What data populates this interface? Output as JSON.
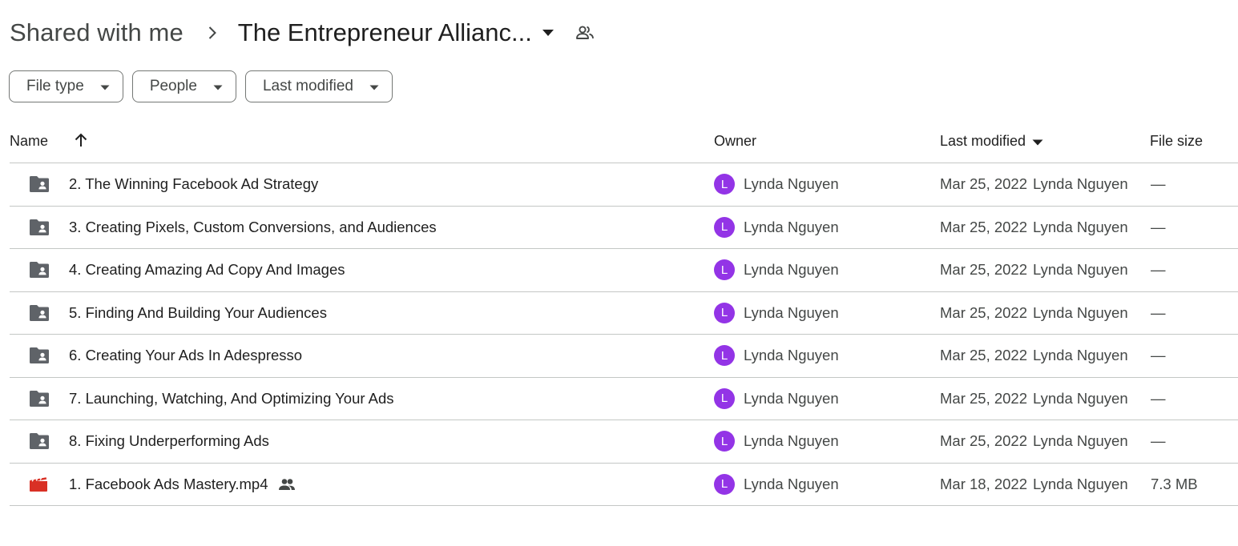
{
  "breadcrumb": {
    "root": "Shared with me",
    "current": "The Entrepreneur Allianc...",
    "separator_icon": "chevron-right-icon",
    "dropdown_icon": "arrow-drop-down-icon",
    "people_icon": "people-outline-icon"
  },
  "filters": [
    {
      "label": "File type"
    },
    {
      "label": "People"
    },
    {
      "label": "Last modified"
    }
  ],
  "table": {
    "columns": {
      "name": "Name",
      "owner": "Owner",
      "last_modified": "Last modified",
      "file_size": "File size"
    },
    "sort": {
      "column": "name",
      "direction": "ascending",
      "icon": "arrow-up-icon"
    },
    "rows": [
      {
        "type": "shared-folder",
        "name": "2. The Winning Facebook Ad Strategy",
        "owner_initial": "L",
        "owner": "Lynda Nguyen",
        "modified_date": "Mar 25, 2022",
        "modified_by": "Lynda Nguyen",
        "size": "—",
        "shared": false
      },
      {
        "type": "shared-folder",
        "name": "3. Creating Pixels, Custom Conversions, and Audiences",
        "owner_initial": "L",
        "owner": "Lynda Nguyen",
        "modified_date": "Mar 25, 2022",
        "modified_by": "Lynda Nguyen",
        "size": "—",
        "shared": false
      },
      {
        "type": "shared-folder",
        "name": "4. Creating Amazing Ad Copy And Images",
        "owner_initial": "L",
        "owner": "Lynda Nguyen",
        "modified_date": "Mar 25, 2022",
        "modified_by": "Lynda Nguyen",
        "size": "—",
        "shared": false
      },
      {
        "type": "shared-folder",
        "name": "5. Finding And Building Your Audiences",
        "owner_initial": "L",
        "owner": "Lynda Nguyen",
        "modified_date": "Mar 25, 2022",
        "modified_by": "Lynda Nguyen",
        "size": "—",
        "shared": false
      },
      {
        "type": "shared-folder",
        "name": "6. Creating Your Ads In Adespresso",
        "owner_initial": "L",
        "owner": "Lynda Nguyen",
        "modified_date": "Mar 25, 2022",
        "modified_by": "Lynda Nguyen",
        "size": "—",
        "shared": false
      },
      {
        "type": "shared-folder",
        "name": "7. Launching, Watching, And Optimizing Your Ads",
        "owner_initial": "L",
        "owner": "Lynda Nguyen",
        "modified_date": "Mar 25, 2022",
        "modified_by": "Lynda Nguyen",
        "size": "—",
        "shared": false
      },
      {
        "type": "shared-folder",
        "name": "8. Fixing Underperforming Ads",
        "owner_initial": "L",
        "owner": "Lynda Nguyen",
        "modified_date": "Mar 25, 2022",
        "modified_by": "Lynda Nguyen",
        "size": "—",
        "shared": false
      },
      {
        "type": "video",
        "name": "1. Facebook Ads Mastery.mp4",
        "owner_initial": "L",
        "owner": "Lynda Nguyen",
        "modified_date": "Mar 18, 2022",
        "modified_by": "Lynda Nguyen",
        "size": "7.3 MB",
        "shared": true
      }
    ]
  },
  "colors": {
    "avatar": "#9334e6",
    "folder_icon": "#5f6368",
    "video_icon": "#d93025",
    "divider": "#c4c7c5"
  }
}
